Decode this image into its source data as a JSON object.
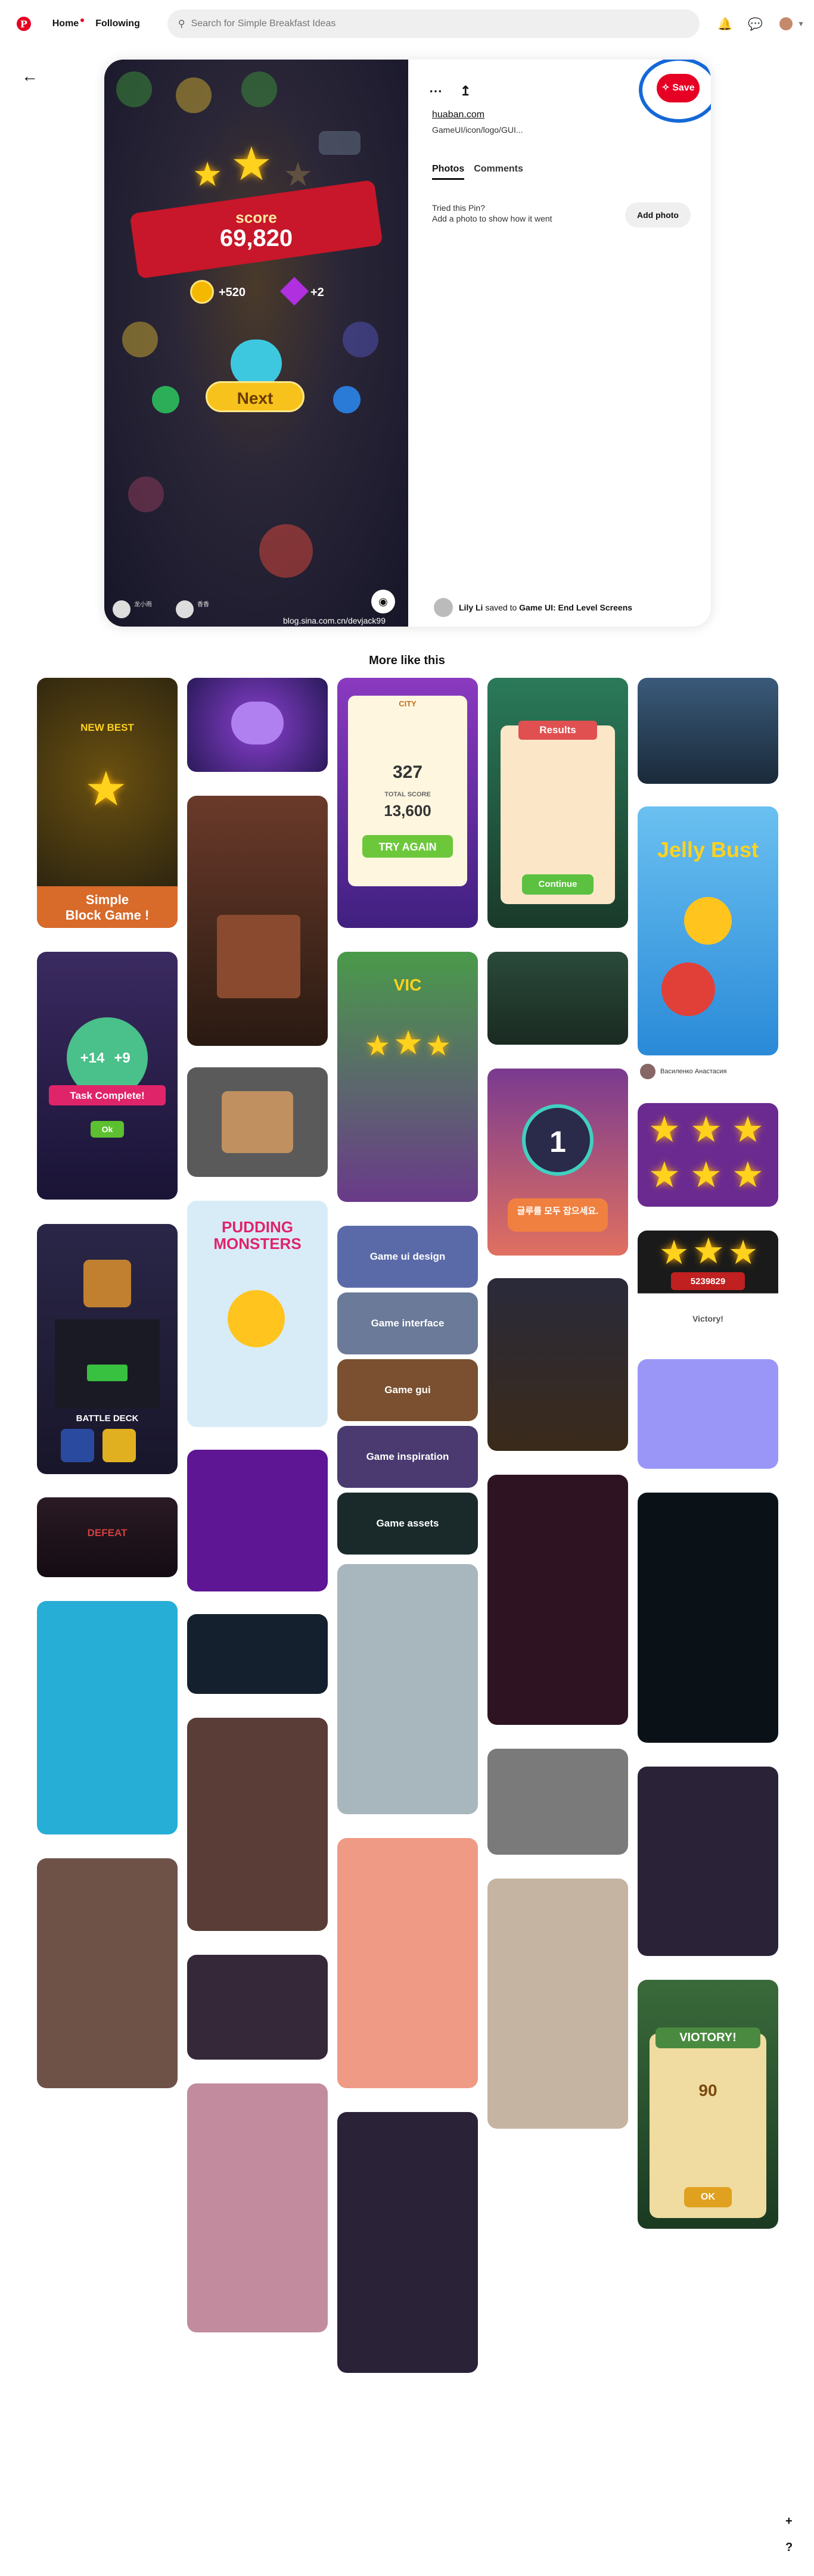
{
  "header": {
    "logo": "P",
    "home_label": "Home",
    "following_label": "Following",
    "search_placeholder": "Search for Simple Breakfast Ideas",
    "icons": [
      "bell-icon",
      "messages-icon",
      "avatar",
      "chevron-down-icon"
    ]
  },
  "pin": {
    "score_label": "score",
    "score_value": "69,820",
    "coins_reward": "+520",
    "gems_reward": "+2",
    "next_label": "Next",
    "image_source_text": "blog.sina.com.cn/devjack99",
    "link_text": "huaban.com",
    "description": "GameUI/icon/logo/GUI...",
    "tabs": [
      "Photos",
      "Comments"
    ],
    "tried_line1": "Tried this Pin?",
    "tried_line2": "Add a photo to show how it went",
    "add_photo_label": "Add photo",
    "save_label": "Save",
    "saver_name": "Lily Li",
    "saved_to_text": "saved to",
    "board_name": "Game UI: End Level Screens",
    "image_user1": "龙小雨",
    "image_user2": "香香"
  },
  "more_like_this": "More like this",
  "cards": {
    "new_best_title": "NEW BEST",
    "new_best_caption1": "Simple",
    "new_best_caption2": "Block Game !",
    "results_title": "Results",
    "continue_label": "Continue",
    "city_title": "CITY",
    "city_score": "327",
    "total_score_label": "TOTAL SCORE",
    "total_score_value": "13,600",
    "try_again_label": "TRY AGAIN",
    "jelly_title": "Jelly Bust",
    "task_complete_label": "Task Complete!",
    "task_ok": "Ok",
    "task_left": "+14",
    "task_right": "+9",
    "pudding_title": "PUDDING MONSTERS",
    "battle_deck_label": "BATTLE DECK",
    "victory_title": "VIC",
    "number_card_value": "1",
    "korean_button": "글루를 모두 잡으세요.",
    "score_display": "5239829",
    "victory_label": "Victory!",
    "defeat_label": "DEFEAT",
    "game_ui_design": "Game ui design",
    "game_interface": "Game interface",
    "game_gui": "Game gui",
    "game_inspiration": "Game inspiration",
    "game_assets": "Game assets",
    "viotory_title": "VIOTORY!",
    "viotory_score": "90",
    "viotory_ok": "OK",
    "card_user": "Василенко Анастасия"
  },
  "fabs": [
    "+",
    "?"
  ]
}
